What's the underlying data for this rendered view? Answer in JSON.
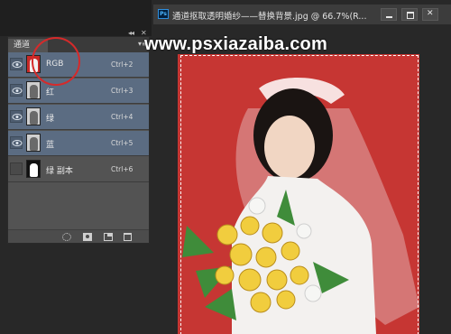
{
  "channels_panel": {
    "tab_label": "通道",
    "collapse_glyph": "◂◂",
    "close_glyph": "✕",
    "menu_glyph": "▾≡",
    "rows": [
      {
        "name": "RGB",
        "shortcut": "Ctrl+2",
        "visible": true,
        "selected": true,
        "thumbnail": "color"
      },
      {
        "name": "红",
        "shortcut": "Ctrl+3",
        "visible": true,
        "selected": true,
        "thumbnail": "grayscale"
      },
      {
        "name": "绿",
        "shortcut": "Ctrl+4",
        "visible": true,
        "selected": true,
        "thumbnail": "grayscale"
      },
      {
        "name": "蓝",
        "shortcut": "Ctrl+5",
        "visible": true,
        "selected": true,
        "thumbnail": "grayscale"
      },
      {
        "name": "绿 副本",
        "shortcut": "Ctrl+6",
        "visible": false,
        "selected": false,
        "thumbnail": "mask"
      }
    ],
    "footer_icons": [
      "load-channel-as-selection-icon",
      "save-selection-as-channel-icon",
      "new-channel-icon",
      "trash-icon"
    ],
    "selected_row_color": "#5b6c82",
    "annotation_circle_color": "#d62a2a"
  },
  "document": {
    "title": "通道抠取透明婚纱——替换背景.jpg @ 66.7%(R...",
    "app_icon_label": "Ps",
    "watermark": "www.psxiazaiba.com",
    "canvas_color": "#c63633",
    "window_buttons": [
      "minimize",
      "maximize",
      "close"
    ]
  }
}
